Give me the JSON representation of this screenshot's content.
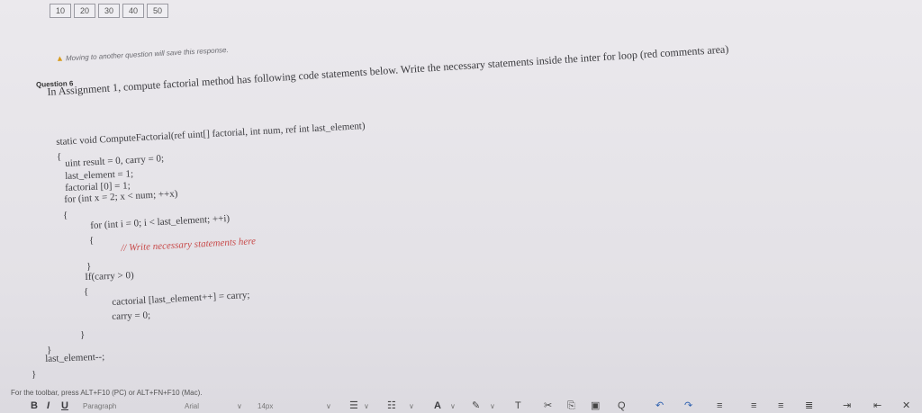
{
  "pager": [
    "10",
    "20",
    "30",
    "40",
    "50"
  ],
  "notice": "Moving to another question will save this response.",
  "question_label": "Question 6",
  "prompt": "In Assignment 1, compute factorial method has following code statements below. Write the necessary statements inside the inter for loop (red comments area)",
  "code": {
    "signature": "static void ComputeFactorial(ref uint[] factorial, int num, ref int last_element)",
    "open_brace": "{",
    "line1": "uint result = 0, carry = 0;",
    "line2": "last_element = 1;",
    "line3": "factorial [0] = 1;",
    "line4": "for (int x = 2; x < num; ++x)",
    "open2": "{",
    "line5": "for (int i = 0; i < last_element; ++i)",
    "open3": "{",
    "comment": "// Write necessary statements here",
    "close3": "}",
    "line6": "If(carry > 0)",
    "open4": "{",
    "line7": "cactorial [last_element++] = carry;",
    "line8": "carry = 0;",
    "close4": "}",
    "close2": "}",
    "line9": "last_element--;",
    "close1": "}"
  },
  "toolbar_hint": "For the toolbar, press ALT+F10 (PC) or ALT+FN+F10 (Mac).",
  "toolbar": {
    "font_family": "Arial",
    "font_size": "14px",
    "paragraph": "Paragraph",
    "text_color": "A"
  },
  "icons": [
    "bold-icon",
    "italic-icon",
    "underline-icon",
    "bullet-list-icon",
    "numbered-list-icon",
    "text-color-icon",
    "highlight-icon",
    "clear-format-icon",
    "cut-icon",
    "copy-icon",
    "paste-icon",
    "find-icon",
    "undo-icon",
    "redo-icon",
    "align-left-icon",
    "align-center-icon",
    "align-right-icon",
    "justify-icon",
    "indent-icon",
    "outdent-icon",
    "close-icon"
  ]
}
